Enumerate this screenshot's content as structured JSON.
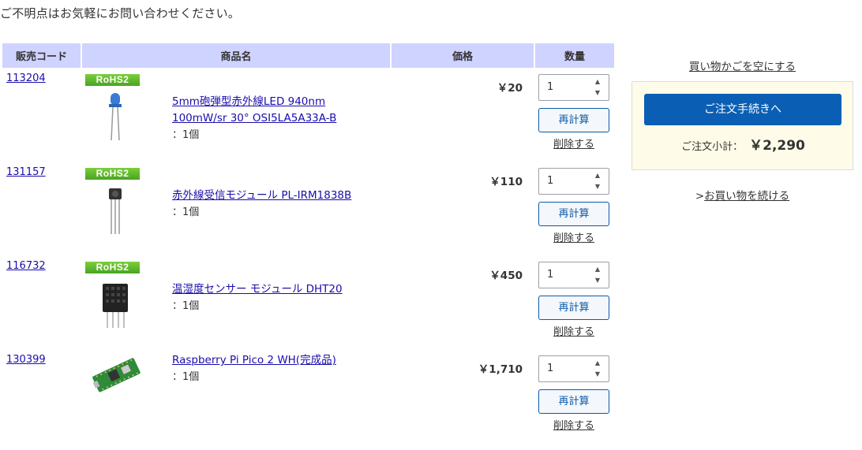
{
  "intro": "ご不明点はお気軽にお問い合わせください。",
  "table": {
    "headers": {
      "code": "販売コード",
      "name": "商品名",
      "price": "価格",
      "qty": "数量"
    },
    "items": [
      {
        "code": "113204",
        "rohs": "RoHS2",
        "name_lines": [
          "5mm砲弾型赤外線LED 940nm",
          "100mW/sr 30° OSI5LA5A33A-B"
        ],
        "qty_label": "：1個",
        "price": "￥20",
        "qty": "1",
        "recalc": "再計算",
        "delete": "削除する"
      },
      {
        "code": "131157",
        "rohs": "RoHS2",
        "name_lines": [
          "赤外線受信モジュール PL-IRM1838B"
        ],
        "qty_label": "：1個",
        "price": "￥110",
        "qty": "1",
        "recalc": "再計算",
        "delete": "削除する"
      },
      {
        "code": "116732",
        "rohs": "RoHS2",
        "name_lines": [
          "温湿度センサー モジュール DHT20"
        ],
        "qty_label": "：1個",
        "price": "￥450",
        "qty": "1",
        "recalc": "再計算",
        "delete": "削除する"
      },
      {
        "code": "130399",
        "rohs": "",
        "name_lines": [
          "Raspberry Pi Pico 2 WH(完成品)"
        ],
        "qty_label": "：1個",
        "price": "￥1,710",
        "qty": "1",
        "recalc": "再計算",
        "delete": "削除する"
      }
    ]
  },
  "sidebar": {
    "empty_cart": "買い物かごを空にする",
    "checkout": "ご注文手続きへ",
    "subtotal_label": "ご注文小計：",
    "subtotal_value": "￥2,290",
    "continue_prefix": ">",
    "continue_link": "お買い物を続ける"
  },
  "colors": {
    "header_bg": "#cfd3ff",
    "checkout_bg": "#0a5fb4",
    "summary_bg": "#fefce8",
    "rohs_green": "#4aa423",
    "link": "#1a0dab"
  }
}
